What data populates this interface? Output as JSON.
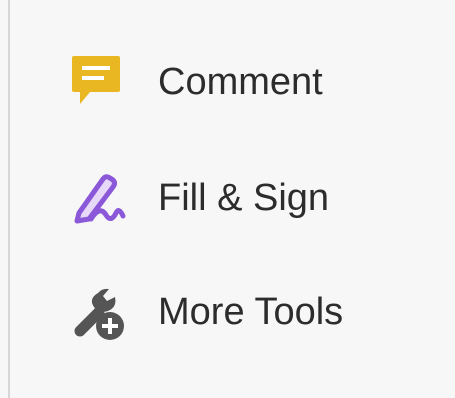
{
  "tools_panel": {
    "items": [
      {
        "label": "Comment",
        "icon": "comment-icon",
        "icon_color": "#e8b722"
      },
      {
        "label": "Fill & Sign",
        "icon": "fill-sign-icon",
        "icon_color": "#8a58d8"
      },
      {
        "label": "More Tools",
        "icon": "more-tools-icon",
        "icon_color": "#555555"
      }
    ]
  }
}
